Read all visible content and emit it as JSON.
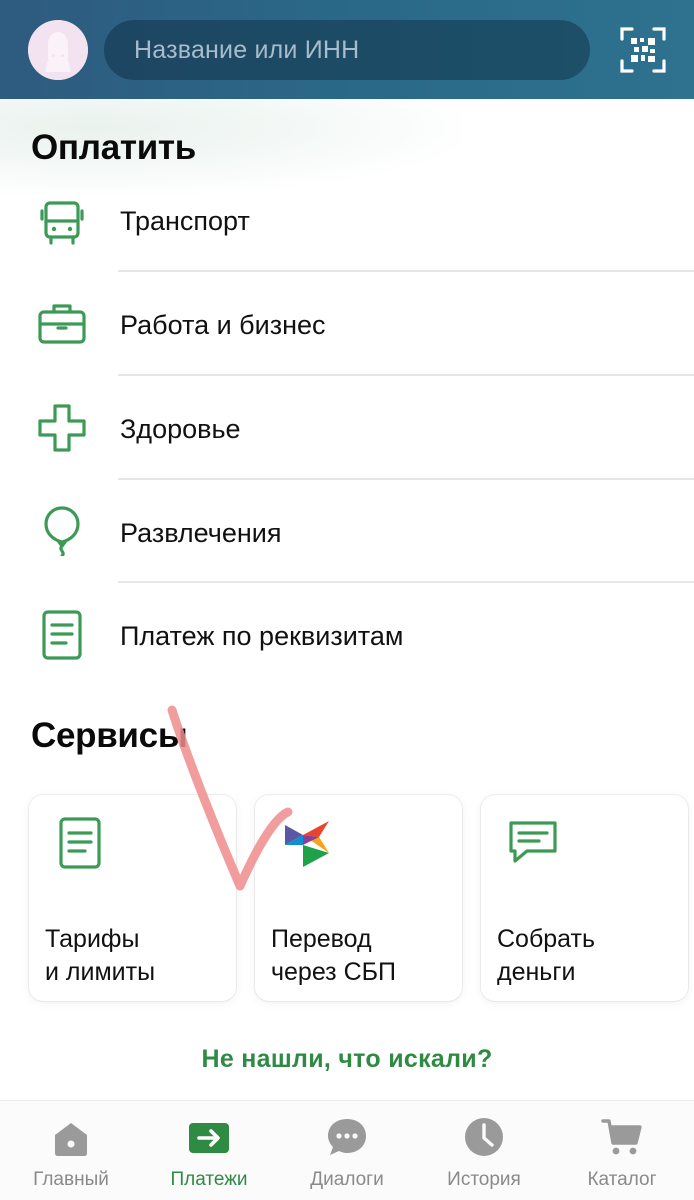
{
  "header": {
    "search_placeholder": "Название или ИНН"
  },
  "pay": {
    "title": "Оплатить",
    "items": [
      {
        "label": "Транспорт",
        "icon": "bus-icon"
      },
      {
        "label": "Работа и бизнес",
        "icon": "briefcase-icon"
      },
      {
        "label": "Здоровье",
        "icon": "medical-cross-icon"
      },
      {
        "label": "Развлечения",
        "icon": "balloon-icon"
      },
      {
        "label": "Платеж по реквизитам",
        "icon": "document-icon"
      }
    ]
  },
  "services": {
    "title": "Сервисы",
    "cards": [
      {
        "line1": "Тарифы",
        "line2": "и лимиты",
        "icon": "document-icon"
      },
      {
        "line1": "Перевод",
        "line2": "через СБП",
        "icon": "sbp-logo-icon"
      },
      {
        "line1": "Собрать",
        "line2": "деньги",
        "icon": "chat-bubble-icon"
      }
    ]
  },
  "not_found_link": "Не нашли, что искали?",
  "tabs": [
    {
      "label": "Главный",
      "icon": "home-icon",
      "active": false
    },
    {
      "label": "Платежи",
      "icon": "payment-arrow-icon",
      "active": true
    },
    {
      "label": "Диалоги",
      "icon": "chat-dots-icon",
      "active": false
    },
    {
      "label": "История",
      "icon": "clock-icon",
      "active": false
    },
    {
      "label": "Каталог",
      "icon": "cart-icon",
      "active": false
    }
  ],
  "colors": {
    "header_bg": "#2e6788",
    "accent_green": "#2f8a44",
    "icon_green": "#3d9a56",
    "tab_inactive": "#8a8a8a",
    "annotation_red": "#f08c8c"
  }
}
